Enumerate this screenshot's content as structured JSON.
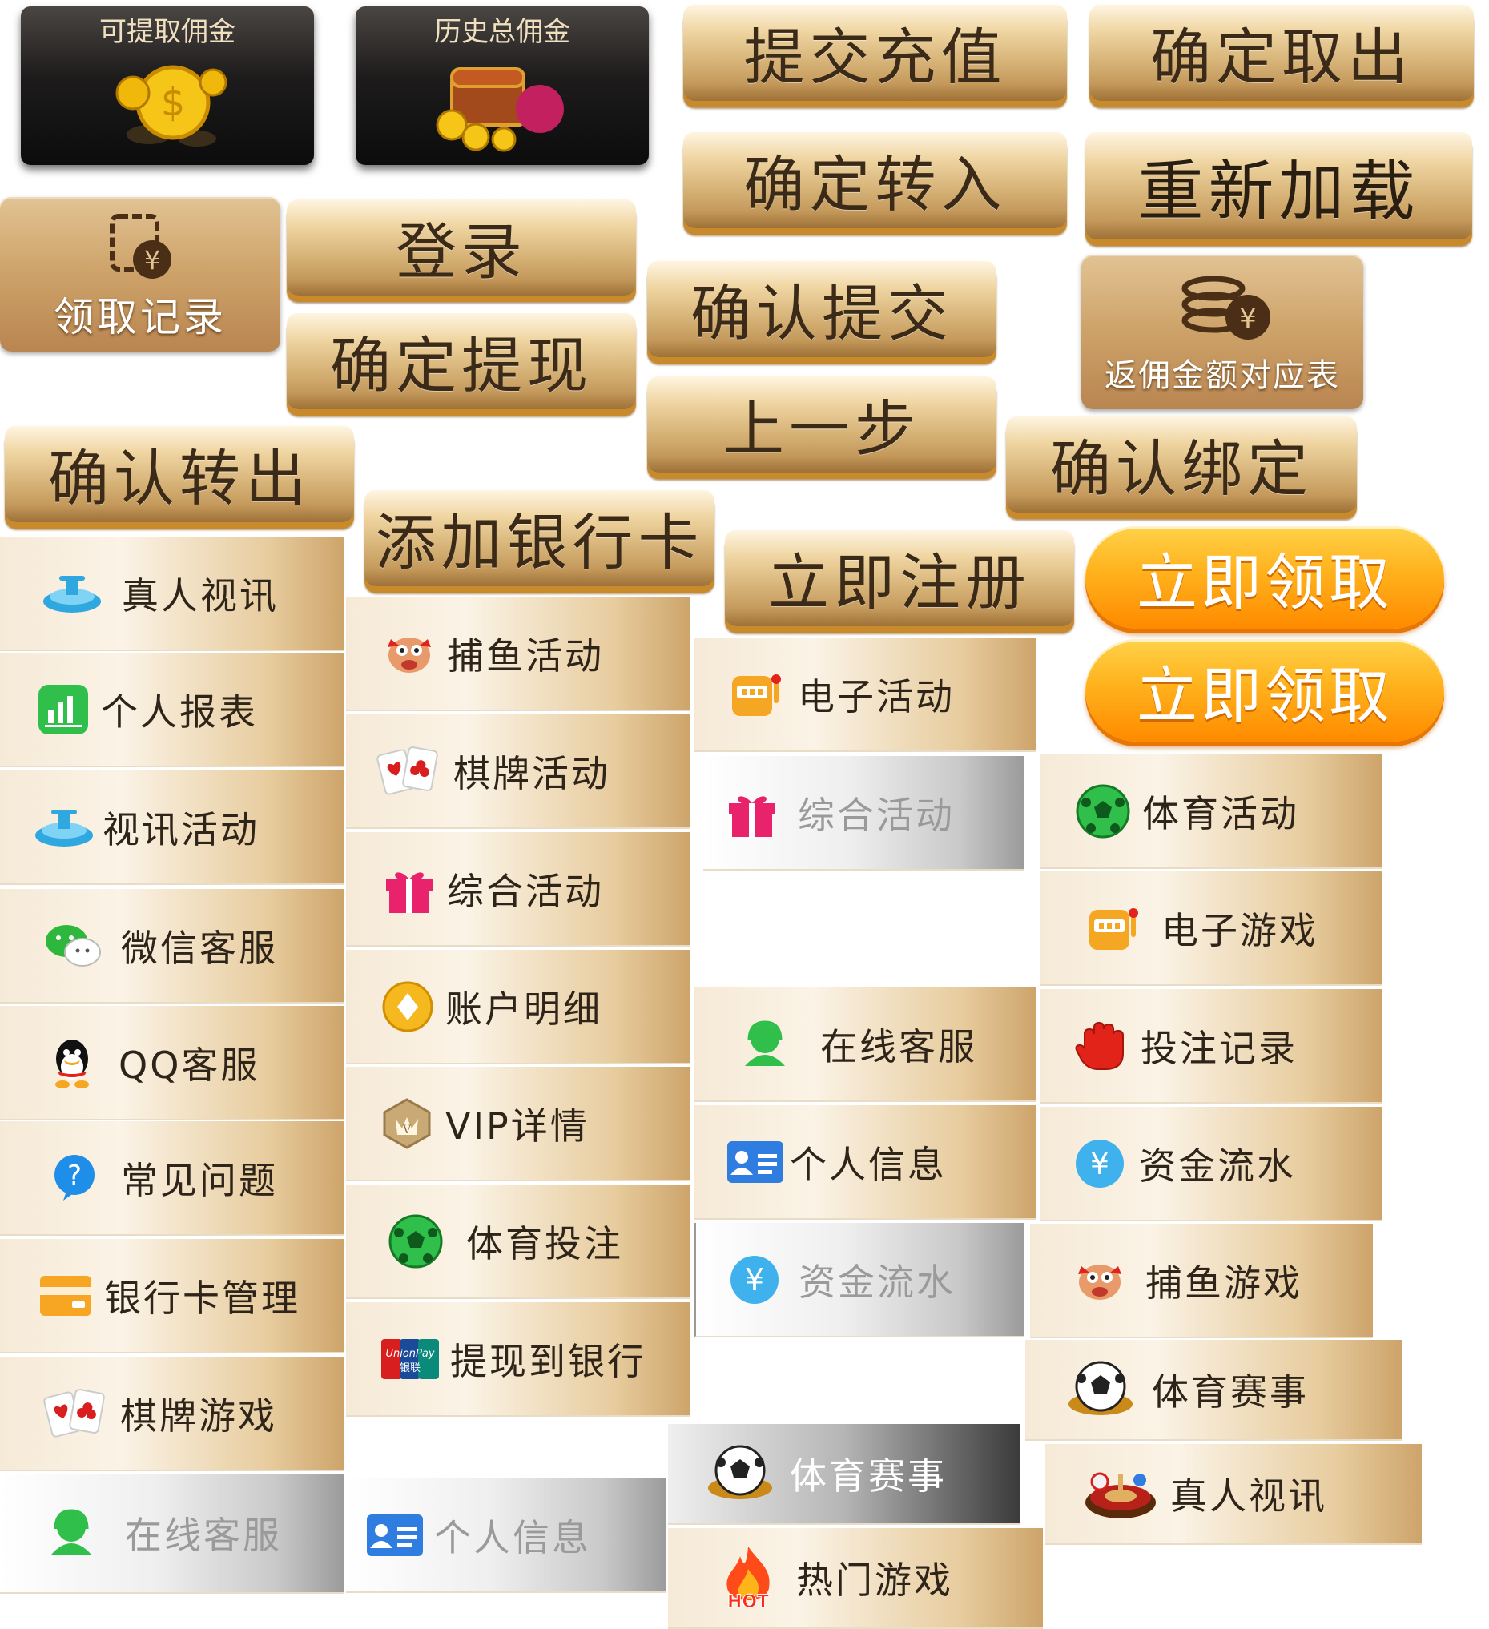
{
  "cards": {
    "withdrawable": "可提取佣金",
    "total": "历史总佣金"
  },
  "buttons": {
    "submit_recharge": "提交充值",
    "confirm_withdraw_out": "确定取出",
    "confirm_transfer_in": "确定转入",
    "reload": "重新加载",
    "login": "登录",
    "confirm_withdraw": "确定提现",
    "confirm_submit": "确认提交",
    "previous_step": "上一步",
    "confirm_transfer_out": "确认转出",
    "add_bank_card": "添加银行卡",
    "confirm_bind": "确认绑定",
    "register_now": "立即注册",
    "claim_now_1": "立即领取",
    "claim_now_2": "立即领取",
    "claim_record": "领取记录",
    "commission_table": "返佣金额对应表"
  },
  "col1": [
    {
      "label": "真人视讯",
      "icon": "live-video-icon"
    },
    {
      "label": "个人报表",
      "icon": "report-icon"
    },
    {
      "label": "视讯活动",
      "icon": "live-video-icon"
    },
    {
      "label": "微信客服",
      "icon": "wechat-icon"
    },
    {
      "label": "QQ客服",
      "icon": "qq-icon"
    },
    {
      "label": "常见问题",
      "icon": "question-icon"
    },
    {
      "label": "银行卡管理",
      "icon": "bank-card-icon"
    },
    {
      "label": "棋牌游戏",
      "icon": "cards-icon"
    },
    {
      "label": "在线客服",
      "icon": "support-icon"
    }
  ],
  "col2": [
    {
      "label": "捕鱼活动",
      "icon": "fish-icon"
    },
    {
      "label": "棋牌活动",
      "icon": "cards-icon"
    },
    {
      "label": "综合活动",
      "icon": "gift-icon"
    },
    {
      "label": "账户明细",
      "icon": "diamond-coin-icon"
    },
    {
      "label": "VIP详情",
      "icon": "vip-icon"
    },
    {
      "label": "体育投注",
      "icon": "soccer-ball-icon"
    },
    {
      "label": "提现到银行",
      "icon": "unionpay-icon"
    },
    {
      "label": "个人信息",
      "icon": "id-card-icon"
    }
  ],
  "col3": [
    {
      "label": "电子活动",
      "icon": "slot-machine-icon"
    },
    {
      "label": "综合活动",
      "icon": "gift-icon"
    },
    {
      "label": "在线客服",
      "icon": "support-icon"
    },
    {
      "label": "个人信息",
      "icon": "id-card-icon"
    },
    {
      "label": "资金流水",
      "icon": "yuan-coin-icon"
    },
    {
      "label": "体育赛事",
      "icon": "soccer-ball-icon"
    },
    {
      "label": "热门游戏",
      "icon": "hot-fire-icon"
    }
  ],
  "col4": [
    {
      "label": "体育活动",
      "icon": "soccer-ball-icon"
    },
    {
      "label": "电子游戏",
      "icon": "slot-machine-icon"
    },
    {
      "label": "投注记录",
      "icon": "hand-icon"
    },
    {
      "label": "资金流水",
      "icon": "yuan-coin-icon"
    },
    {
      "label": "捕鱼游戏",
      "icon": "fish-icon"
    },
    {
      "label": "体育赛事",
      "icon": "soccer-ball-icon"
    },
    {
      "label": "真人视讯",
      "icon": "roulette-icon"
    }
  ],
  "badges": {
    "hot": "HOT",
    "unionpay_en": "UnionPay",
    "unionpay_cn": "银联",
    "yuan": "¥",
    "vip_v": "V",
    "qa": "?"
  }
}
